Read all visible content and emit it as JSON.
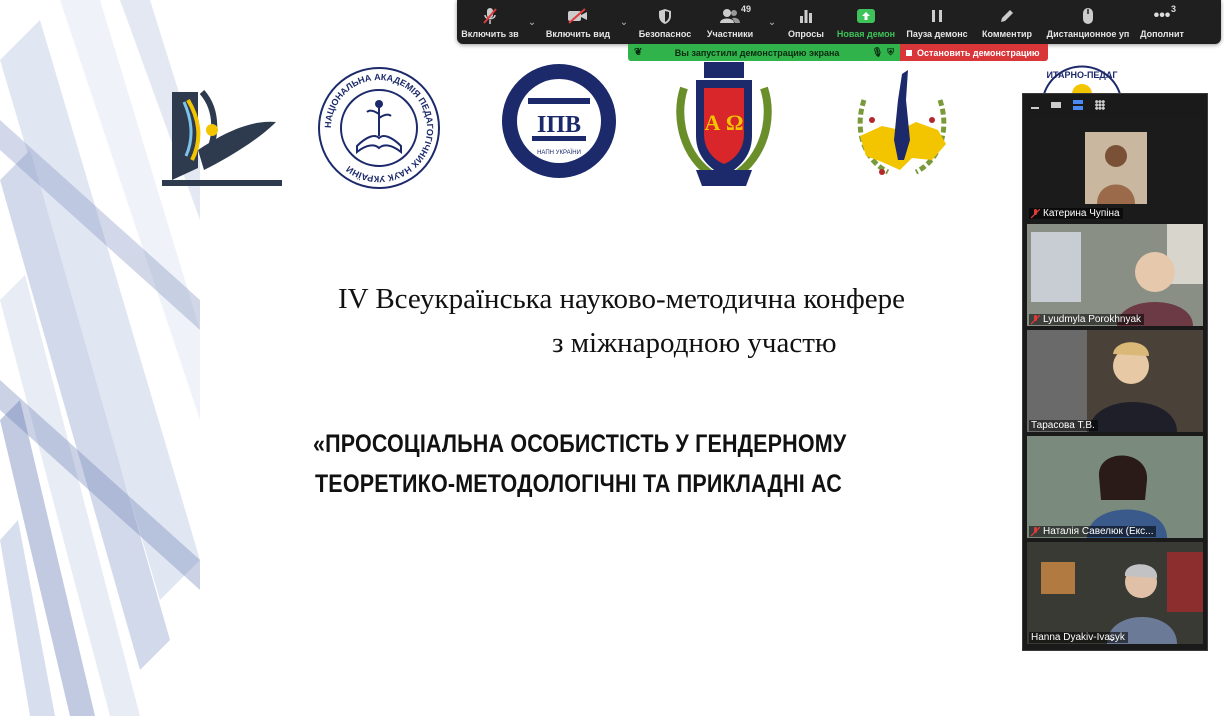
{
  "toolbar": {
    "mute": "Включить зв",
    "video": "Включить вид",
    "security": "Безопаснос",
    "participants": "Участники",
    "participants_count": "49",
    "polls": "Опросы",
    "new_share": "Новая демон",
    "pause_share": "Пауза демонс",
    "annotate": "Комментир",
    "remote": "Дистанционное уп",
    "more": "Дополнит",
    "more_count": "3"
  },
  "share_banner": {
    "message": "Вы запустили демонстрацию экрана",
    "stop": "Остановить демонстрацию"
  },
  "slide": {
    "line1": "IV Всеукраїнська науково-методична конфере",
    "line2": "з міжнародною участю",
    "line3": "«ПРОСОЦІАЛЬНА ОСОБИСТІСТЬ У ГЕНДЕРНОМУ",
    "line4": "ТЕОРЕТИКО-МЕТОДОЛОГІЧНІ ТА ПРИКЛАДНІ АС"
  },
  "logos": {
    "napn_ring": "НАЦІОНАЛЬНА АКАДЕМІЯ ПЕДАГОГІЧНИХ НАУК УКРАЇНИ",
    "ipv_letters": "ІПВ",
    "ipv_small": "НАПН УКРАЇНИ",
    "university_letters": "А Ω",
    "partial_ring": "ИТАРНО-ПЕДАГ"
  },
  "participants": [
    {
      "name": "Катерина Чупіна",
      "muted": true
    },
    {
      "name": "Lyudmyla Porokhnyak",
      "muted": true
    },
    {
      "name": "Тарасова Т.В.",
      "muted": false
    },
    {
      "name": "Наталія Савелюк (Екс...",
      "muted": true
    },
    {
      "name": "Hanna Dyakiv-Ivasyk",
      "muted": false
    }
  ],
  "colors": {
    "toolbar_bg": "#1f1f1f",
    "share_green": "#2fb34a",
    "share_red": "#d9363a",
    "navy": "#1c2a6b",
    "accent_yellow": "#f2c500"
  }
}
